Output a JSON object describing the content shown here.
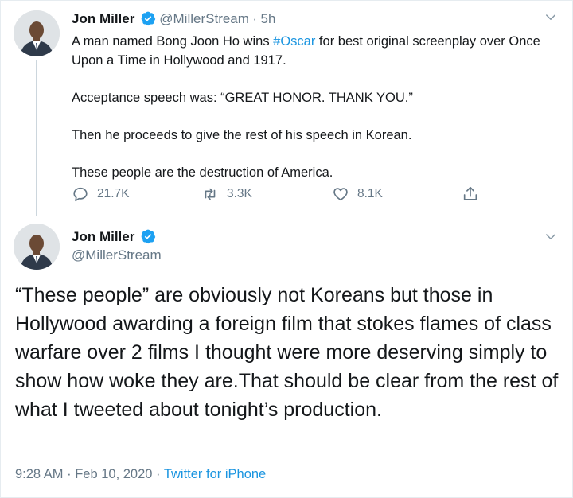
{
  "tweet1": {
    "author_name": "Jon Miller",
    "handle": "@MillerStream",
    "separator": "·",
    "time": "5h",
    "text_part1": "A man named Bong Joon Ho wins ",
    "hashtag": "#Oscar",
    "text_part2": " for best original screenplay over Once Upon a Time in Hollywood and 1917.",
    "paragraph2": "Acceptance speech was: “GREAT HONOR. THANK YOU.”",
    "paragraph3": "Then he proceeds to give the rest of his speech in Korean.",
    "paragraph4": "These people are the destruction of America.",
    "replies": "21.7K",
    "retweets": "3.3K",
    "likes": "8.1K"
  },
  "tweet2": {
    "author_name": "Jon Miller",
    "handle": "@MillerStream",
    "text": "“These people” are obviously not Koreans but those in Hollywood awarding a foreign film that stokes flames of class warfare over 2 films I thought were more deserving simply to show how woke they are.That should be clear from the rest of what I tweeted about tonight’s production.",
    "timestamp": "9:28 AM · Feb 10, 2020",
    "separator": " · ",
    "source": "Twitter for iPhone"
  },
  "colors": {
    "link": "#1b95e0",
    "muted": "#657786",
    "verified": "#1da1f2"
  }
}
